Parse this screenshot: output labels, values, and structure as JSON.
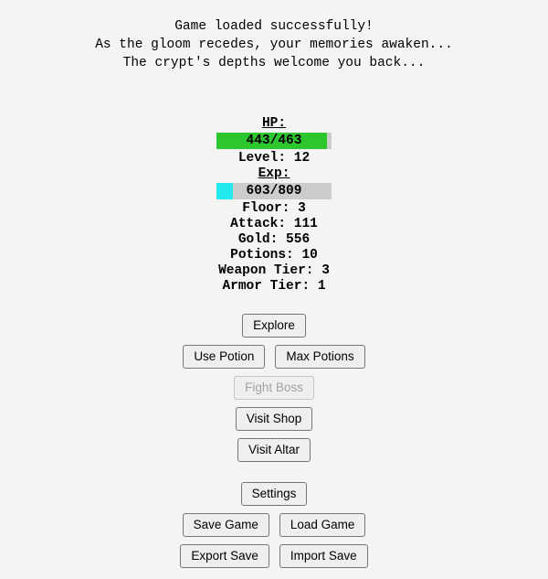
{
  "intro": {
    "line1": "Game loaded successfully!",
    "line2": "As the gloom recedes, your memories awaken...",
    "line3": "The crypt's depths welcome you back..."
  },
  "stats": {
    "hp": {
      "label": "HP:",
      "text": "443/463",
      "current": 443,
      "max": 463,
      "fill_percent": 96,
      "color": "#2ec62e"
    },
    "level": {
      "text": "Level: 12",
      "label": "Level:",
      "value": 12
    },
    "exp": {
      "label": "Exp:",
      "text": "603/809",
      "current": 603,
      "max": 809,
      "fill_percent": 14,
      "color": "#22e8f0"
    },
    "lines": [
      {
        "text": "Floor: 3",
        "label": "Floor:",
        "value": 3
      },
      {
        "text": "Attack: 111",
        "label": "Attack:",
        "value": 111
      },
      {
        "text": "Gold: 556",
        "label": "Gold:",
        "value": 556
      },
      {
        "text": "Potions: 10",
        "label": "Potions:",
        "value": 10
      },
      {
        "text": "Weapon Tier: 3",
        "label": "Weapon Tier:",
        "value": 3
      },
      {
        "text": "Armor Tier: 1",
        "label": "Armor Tier:",
        "value": 1
      }
    ],
    "track_color": "#cccccc"
  },
  "actions": {
    "explore": "Explore",
    "use_potion": "Use Potion",
    "max_potions": "Max Potions",
    "fight_boss": "Fight Boss",
    "fight_boss_disabled": true,
    "visit_shop": "Visit Shop",
    "visit_altar": "Visit Altar",
    "settings": "Settings",
    "save_game": "Save Game",
    "load_game": "Load Game",
    "export_save": "Export Save",
    "import_save": "Import Save"
  },
  "theme": {
    "background": "#f5f4f2",
    "text": "#000000",
    "button_face": "#efefef",
    "button_border": "#767676",
    "disabled_text": "#a3a3a3"
  }
}
